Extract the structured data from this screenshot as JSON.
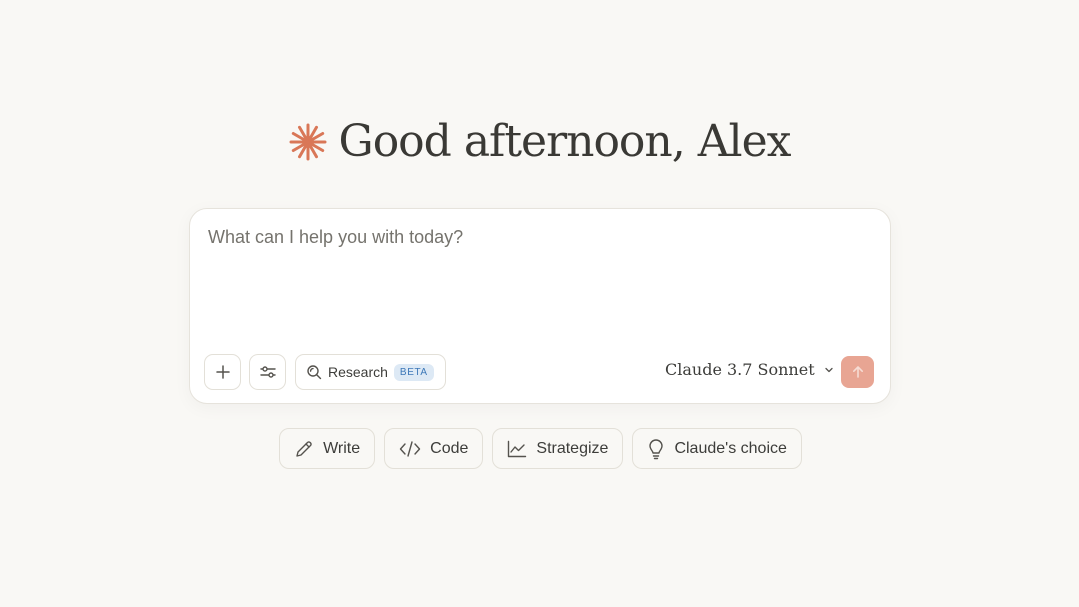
{
  "greeting": {
    "title": "Good afternoon, Alex",
    "icon": "claude-starburst-icon",
    "accent_color": "#d97757"
  },
  "composer": {
    "placeholder": "What can I help you with today?",
    "tools": {
      "add_icon": "plus-icon",
      "settings_icon": "sliders-icon",
      "research_label": "Research",
      "research_badge": "BETA"
    },
    "model": {
      "selected": "Claude 3.7 Sonnet",
      "icon": "chevron-down-icon"
    },
    "send_icon": "arrow-up-icon",
    "send_color": "#e8a593"
  },
  "chips": [
    {
      "label": "Write",
      "icon": "pencil-icon"
    },
    {
      "label": "Code",
      "icon": "code-icon"
    },
    {
      "label": "Strategize",
      "icon": "chart-line-icon"
    },
    {
      "label": "Claude's choice",
      "icon": "lightbulb-icon"
    }
  ]
}
